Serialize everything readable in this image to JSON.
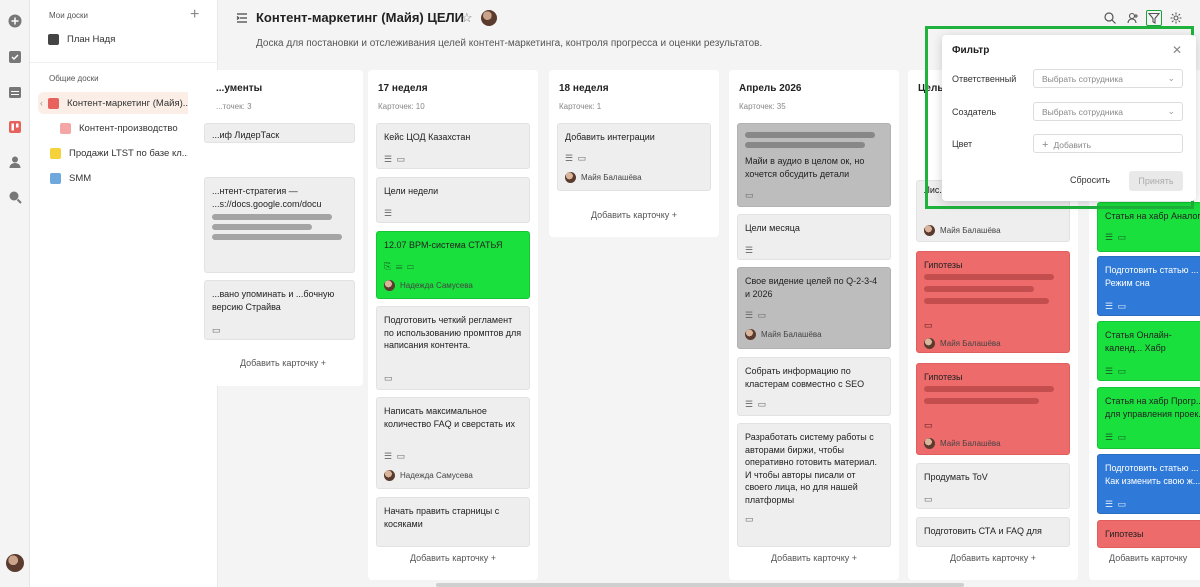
{
  "sidebar": {
    "my_boards_label": "Мои доски",
    "shared_boards_label": "Общие доски",
    "items": [
      {
        "label": "План Надя",
        "color": "#333333"
      },
      {
        "label": "Контент-маркетинг (Майя)...",
        "color": "#e8625d"
      },
      {
        "label": "Контент-производство",
        "color": "#f08a8a"
      },
      {
        "label": "Продажи LTST по базе кл...",
        "color": "#f5d23a"
      },
      {
        "label": "SMM",
        "color": "#6fa8dc"
      }
    ]
  },
  "header": {
    "title": "Контент-маркетинг (Майя) ЦЕЛИ",
    "description": "Доска для постановки и отслеживания целей контент-маркетинга, контроля прогресса и оценки результатов."
  },
  "columns": [
    {
      "title": "...ументы",
      "count": "...точек: 3",
      "add": "Добавить карточку",
      "cards": [
        {
          "text": "...иф ЛидерТаск",
          "icons": "",
          "user": ""
        },
        {
          "text": "...нтент-стратегия — ...s://docs.google.com/docu",
          "icons": "",
          "user": ""
        },
        {
          "text": "...вано упоминать и ...бочную версию Страйва",
          "icons": "",
          "user": ""
        }
      ]
    },
    {
      "title": "17 неделя",
      "count": "Карточек: 10",
      "add": "Добавить карточку",
      "cards": [
        {
          "text": "Кейс ЦОД Казахстан",
          "icons": "☰ ▭",
          "user": ""
        },
        {
          "text": "Цели недели",
          "icons": "☰",
          "user": ""
        },
        {
          "text": "12.07 BPM-система СТАТЬЯ",
          "icons": "⎘ ☰ ▭",
          "user": "Надежда Самусева"
        },
        {
          "text": "Подготовить четкий регламент по использованию промптов для написания контента.",
          "icons": "▭",
          "user": ""
        },
        {
          "text": "Написать максимальное количество FAQ и сверстать их",
          "icons": "☰ ▭",
          "user": "Надежда Самусева"
        },
        {
          "text": "Начать править старницы с косяками",
          "icons": "",
          "user": ""
        }
      ]
    },
    {
      "title": "18 неделя",
      "count": "Карточек: 1",
      "add": "Добавить карточку",
      "cards": [
        {
          "text": "Добавить интеграции",
          "icons": "☰ ▭",
          "user": "Майя Балашёва"
        }
      ]
    },
    {
      "title": "Апрель 2026",
      "count": "Карточек: 35",
      "add": "Добавить карточку",
      "cards": [
        {
          "text": "Майи в аудио в целом ок, но хочется обсудить детали",
          "icons": "▭",
          "user": ""
        },
        {
          "text": "Цели месяца",
          "icons": "☰",
          "user": ""
        },
        {
          "text": "Свое видение целей по Q-2-3-4 и 2026",
          "icons": "☰ ▭",
          "user": "Майя Балашёва"
        },
        {
          "text": "Собрать информацию по кластерам совместно с SEO",
          "icons": "☰ ▭",
          "user": ""
        },
        {
          "text": "Разработать систему работы с авторами биржи, чтобы оперативно готовить материал. И чтобы авторы писали от своего лица, но для нашей платформы",
          "icons": "▭",
          "user": ""
        }
      ]
    },
    {
      "title": "Цель...",
      "count": "",
      "add": "Добавить карточку",
      "cards": [
        {
          "text": "Лис...",
          "icons": "",
          "user": "Майя Балашёва"
        },
        {
          "text": "Гипотезы",
          "icons": "▭",
          "user": "Майя Балашёва"
        },
        {
          "text": "Гипотезы",
          "icons": "▭",
          "user": "Майя Балашёва"
        },
        {
          "text": "Продумать ToV",
          "icons": "▭",
          "user": ""
        },
        {
          "text": "Подготовить СТА и FAQ для",
          "icons": "",
          "user": ""
        }
      ]
    },
    {
      "title": "",
      "count": "",
      "add": "Добавить карточку",
      "cards": [
        {
          "text": "Статья на хабр Аналог...",
          "icons": "☰ ▭",
          "user": ""
        },
        {
          "text": "Подготовить статью ... Режим сна",
          "icons": "☰ ▭",
          "user": ""
        },
        {
          "text": "Статья Онлайн-календ... Хабр",
          "icons": "☰ ▭",
          "user": ""
        },
        {
          "text": "Статья на хабр Прогр... для управления проек...",
          "icons": "☰ ▭",
          "user": ""
        },
        {
          "text": "Подготовить статью ... Как изменить свою ж...",
          "icons": "☰ ▭",
          "user": ""
        },
        {
          "text": "Гипотезы",
          "icons": "",
          "user": ""
        }
      ]
    }
  ],
  "filter": {
    "title": "Фильтр",
    "responsible_label": "Ответственный",
    "responsible_placeholder": "Выбрать сотрудника",
    "creator_label": "Создатель",
    "creator_placeholder": "Выбрать сотрудника",
    "color_label": "Цвет",
    "color_add": "Добавить",
    "reset": "Сбросить",
    "apply": "Принять"
  }
}
